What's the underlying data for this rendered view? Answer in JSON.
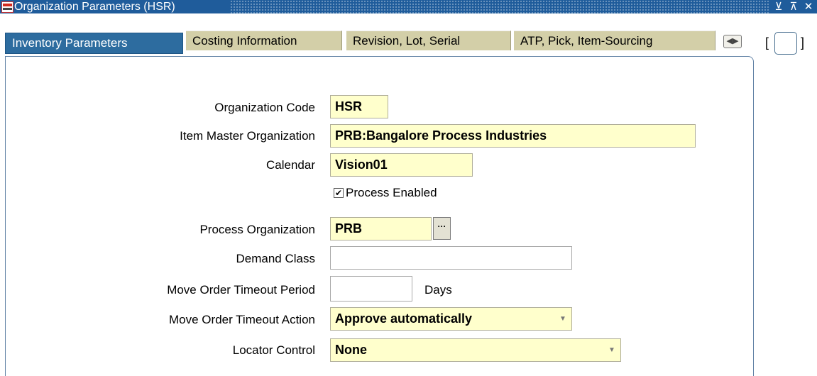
{
  "window": {
    "title": "Organization Parameters (HSR)",
    "buttons": [
      "⊻",
      "⊼",
      "✕"
    ]
  },
  "tabs": [
    {
      "label": "Inventory Parameters",
      "active": true
    },
    {
      "label": "Costing Information",
      "active": false
    },
    {
      "label": "Revision, Lot, Serial",
      "active": false
    },
    {
      "label": "ATP, Pick, Item-Sourcing",
      "active": false
    }
  ],
  "tab_scroll_glyph": "◀▶",
  "brackets": {
    "open": "[",
    "close": "]"
  },
  "form": {
    "organization_code": {
      "label": "Organization Code",
      "value": "HSR"
    },
    "item_master_org": {
      "label": "Item Master Organization",
      "value": "PRB:Bangalore Process Industries"
    },
    "calendar": {
      "label": "Calendar",
      "value": "Vision01"
    },
    "process_enabled": {
      "label": "Process Enabled",
      "checked": true,
      "mark": "✔"
    },
    "process_org": {
      "label": "Process Organization",
      "value": "PRB",
      "lov_glyph": "···"
    },
    "demand_class": {
      "label": "Demand Class",
      "value": ""
    },
    "move_order_timeout_period": {
      "label": "Move Order Timeout Period",
      "value": "",
      "unit": "Days"
    },
    "move_order_timeout_action": {
      "label": "Move Order Timeout Action",
      "value": "Approve automatically"
    },
    "locator_control": {
      "label": "Locator Control",
      "value": "None"
    }
  },
  "colors": {
    "titlebar": "#1f5c9b",
    "active_tab": "#2d6c9f",
    "inactive_tab": "#d3cfa8",
    "required_field": "#ffffcc"
  }
}
